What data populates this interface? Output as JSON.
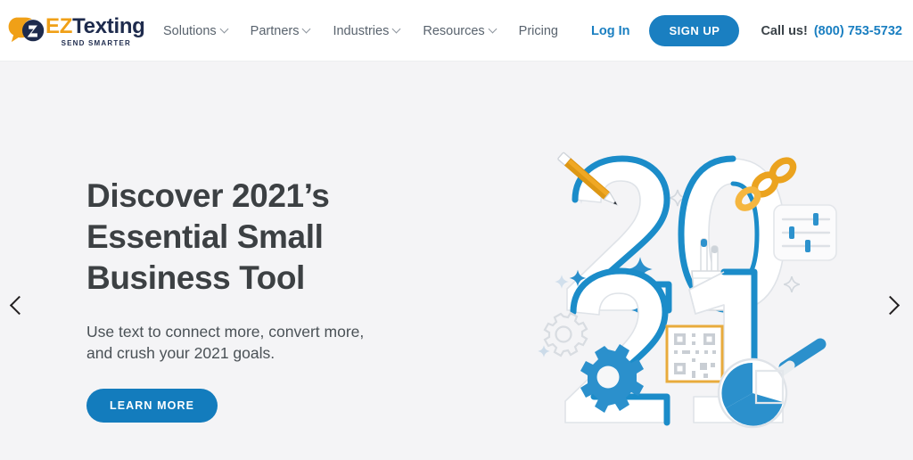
{
  "header": {
    "logo": {
      "icon": "speech-bubble-icon",
      "brand_first": "EZ",
      "brand_second": "Texting",
      "tagline": "SEND SMARTER",
      "orange": "#f0a017",
      "navy": "#1e2b4d"
    },
    "nav": [
      {
        "label": "Solutions",
        "has_dropdown": true
      },
      {
        "label": "Partners",
        "has_dropdown": true
      },
      {
        "label": "Industries",
        "has_dropdown": true
      },
      {
        "label": "Resources",
        "has_dropdown": true
      },
      {
        "label": "Pricing",
        "has_dropdown": false
      }
    ],
    "login_label": "Log In",
    "signup_label": "SIGN UP",
    "call_label": "Call us!",
    "phone": "(800) 753-5732",
    "accent_blue": "#1a7fc1"
  },
  "hero": {
    "title_line1": "Discover 2021’s",
    "title_line2": "Essential Small",
    "title_line3": "Business Tool",
    "subtitle_line1": "Use text to connect more, convert more,",
    "subtitle_line2": "and crush your 2021 goals.",
    "cta_label": "LEARN MORE",
    "background": "#f4f4f6",
    "cta_color": "#137cbd",
    "illustration": {
      "digits_top": "20",
      "digits_bottom": "21",
      "elements": [
        "pencil-icon",
        "chain-link-icon",
        "sliders-panel-icon",
        "pencil-cup-icon",
        "gear-icon",
        "qr-code-icon",
        "magnifier-pie-chart-icon",
        "star-sparkle-icon"
      ],
      "blue": "#1b8cc9",
      "orange": "#e8a12a"
    }
  },
  "carousel": {
    "prev_label": "Previous slide",
    "next_label": "Next slide"
  }
}
